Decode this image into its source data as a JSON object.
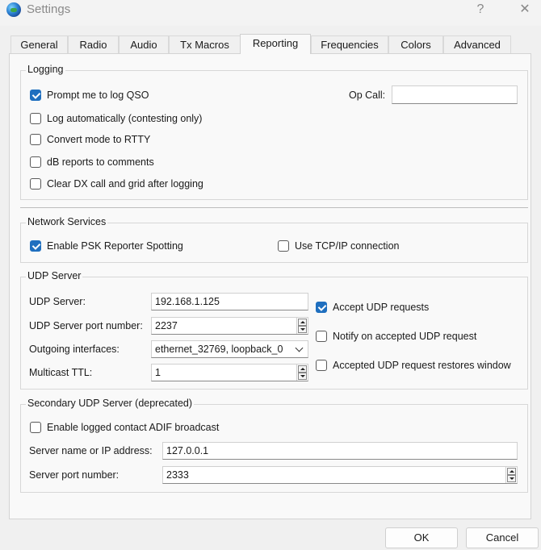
{
  "window": {
    "title": "Settings",
    "help": "?",
    "close": "✕"
  },
  "tabs": [
    "General",
    "Radio",
    "Audio",
    "Tx Macros",
    "Reporting",
    "Frequencies",
    "Colors",
    "Advanced"
  ],
  "logging": {
    "title": "Logging",
    "prompt_qso": "Prompt me to log QSO",
    "log_auto": "Log automatically (contesting only)",
    "convert_rtty": "Convert mode to RTTY",
    "db_reports": "dB reports to comments",
    "clear_dx": "Clear DX call and grid after logging",
    "op_call_label": "Op Call:",
    "op_call_value": ""
  },
  "network": {
    "title": "Network Services",
    "psk": "Enable PSK Reporter Spotting",
    "tcp": "Use TCP/IP connection"
  },
  "udp": {
    "title": "UDP Server",
    "server_label": "UDP Server:",
    "server_value": "192.168.1.125",
    "port_label": "UDP Server port number:",
    "port_value": "2237",
    "iface_label": "Outgoing interfaces:",
    "iface_value": "ethernet_32769, loopback_0",
    "ttl_label": "Multicast TTL:",
    "ttl_value": "1",
    "accept": "Accept UDP requests",
    "notify": "Notify on accepted UDP request",
    "restores": "Accepted UDP request restores window"
  },
  "secondary": {
    "title": "Secondary UDP Server (deprecated)",
    "adif": "Enable logged contact ADIF broadcast",
    "name_label": "Server name or IP address:",
    "name_value": "127.0.0.1",
    "port_label": "Server port number:",
    "port_value": "2333"
  },
  "buttons": {
    "ok": "OK",
    "cancel": "Cancel"
  }
}
